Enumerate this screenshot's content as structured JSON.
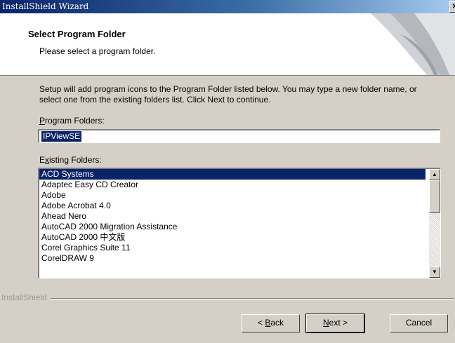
{
  "window": {
    "title": "InstallShield Wizard",
    "close_glyph": "✕"
  },
  "header": {
    "title": "Select Program Folder",
    "subtitle": "Please select a program folder."
  },
  "body": {
    "intro": "Setup will add program icons to the Program Folder listed below.  You may type a new folder name, or select one from the existing folders list.  Click Next to continue."
  },
  "program_folders": {
    "label_accel": "P",
    "label_rest": "rogram Folders:",
    "value": "IPViewSE"
  },
  "existing_folders": {
    "label_first": "E",
    "label_accel": "x",
    "label_rest": "isting Folders:",
    "items": [
      "ACD Systems",
      "Adaptec Easy CD Creator",
      "Adobe",
      "Adobe Acrobat 4.0",
      "Ahead Nero",
      "AutoCAD 2000 Migration Assistance",
      "AutoCAD 2000 中文版",
      "Corel Graphics Suite 11",
      "CorelDRAW 9"
    ],
    "selected_index": 0
  },
  "scrollbar": {
    "up_glyph": "▲",
    "down_glyph": "▼"
  },
  "footer": {
    "brand": "InstallShield",
    "back_prefix": "< ",
    "back_accel": "B",
    "back_rest": "ack",
    "next_accel": "N",
    "next_rest": "ext >",
    "cancel_label": "Cancel"
  },
  "colors": {
    "title_bar": "#0a246a",
    "selection": "#0a246a",
    "dialog_face": "#d4d0c8"
  }
}
